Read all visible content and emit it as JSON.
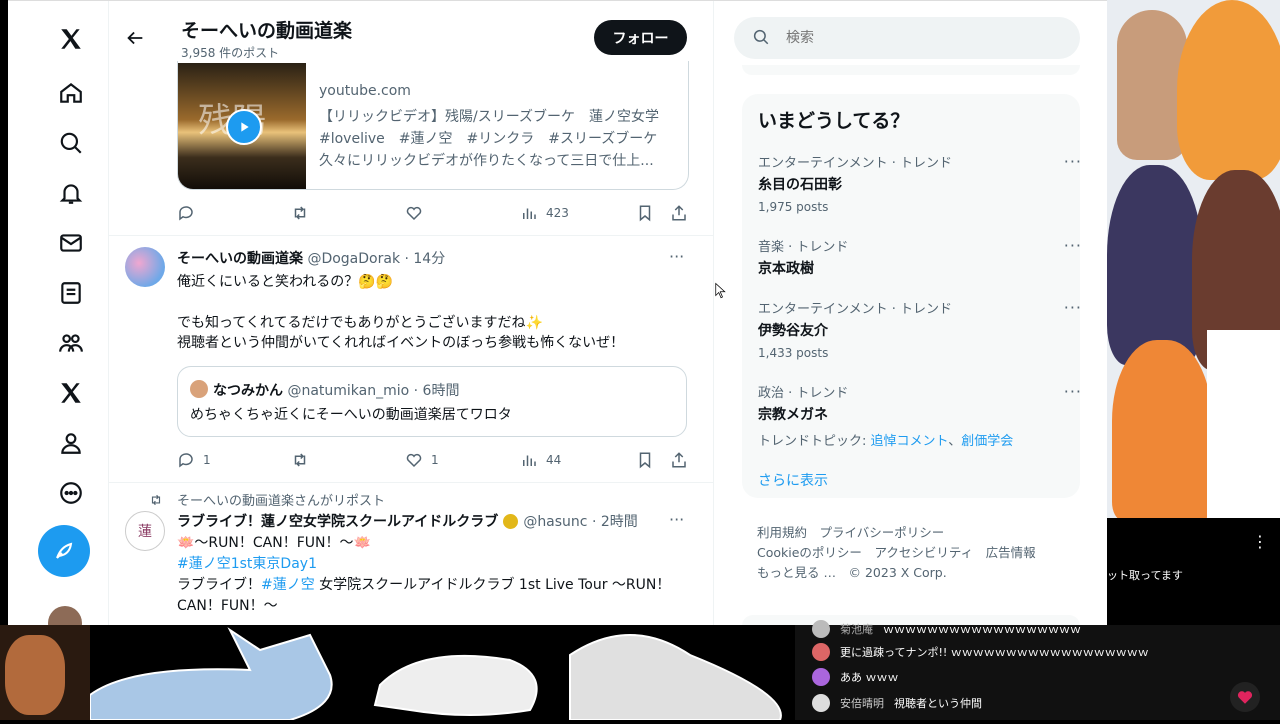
{
  "nav": {
    "icons": [
      "x-logo-icon",
      "home-icon",
      "search-icon",
      "bell-icon",
      "mail-icon",
      "list-icon",
      "communities-icon",
      "premium-x-icon",
      "profile-icon",
      "more-circle-icon"
    ],
    "compose_color": "#1d9bf0"
  },
  "header": {
    "title": "そーへいの動画道楽",
    "posts_count": "3,958 件のポスト",
    "follow_label": "フォロー"
  },
  "card": {
    "domain": "youtube.com",
    "title": "【リリックビデオ】残陽/スリーズブーケ　蓮ノ空女学",
    "tags": "#lovelive　#蓮ノ空　#リンクラ　#スリーズブーケ",
    "desc": "久々にリリックビデオが作りたくなって三日で仕上...",
    "thumb_text": "残陽",
    "views": "423"
  },
  "tweet1": {
    "name": "そーへいの動画道楽",
    "handle": "@DogaDorak · 14分",
    "line1": "俺近くにいると笑われるの？🤔🤔",
    "line2": "でも知ってくれてるだけでもありがとうございますだね✨",
    "line3": "視聴者という仲間がいてくれればイベントのぼっち参戦も怖くないぜ！",
    "quote": {
      "name": "なつみかん",
      "handle": "@natumikan_mio · 6時間",
      "text": "めちゃくちゃ近くにそーへいの動画道楽居てワロタ"
    },
    "replies": "1",
    "likes": "1",
    "views": "44"
  },
  "tweet2": {
    "repost_label": "そーへいの動画道楽さんがリポスト",
    "name": "ラブライブ！蓮ノ空女学院スクールアイドルクラブ",
    "handle": "@hasunc · 2時間",
    "line1": "🪷～RUN！CAN！FUN！～🪷",
    "hashtag": "#蓮ノ空1st東京Day1",
    "line3a": "ラブライブ！",
    "line3tag": "#蓮ノ空",
    "line3b": " 女学院スクールアイドルクラブ 1st Live Tour ～RUN！",
    "line4": "CAN！FUN！～"
  },
  "search": {
    "placeholder": "検索"
  },
  "trends": {
    "title": "いまどうしてる？",
    "items": [
      {
        "meta": "エンターテインメント · トレンド",
        "name": "糸目の石田彰",
        "count": "1,975 posts"
      },
      {
        "meta": "音楽 · トレンド",
        "name": "京本政樹",
        "count": ""
      },
      {
        "meta": "エンターテインメント · トレンド",
        "name": "伊勢谷友介",
        "count": "1,433 posts"
      },
      {
        "meta": "政治 · トレンド",
        "name": "宗教メガネ",
        "count": ""
      }
    ],
    "topic_label": "トレンドトピック: ",
    "topic1": "追悼コメント",
    "topic_sep": "、",
    "topic2": "創価学会",
    "show_more": "さらに表示"
  },
  "footer": {
    "l1a": "利用規約",
    "l1b": "プライバシーポリシー",
    "l2a": "Cookieのポリシー",
    "l2b": "アクセシビリティ",
    "l2c": "広告情報",
    "l3a": "もっと見る …",
    "l3b": "© 2023 X Corp."
  },
  "chat": {
    "top_text": "ット取ってます",
    "lines": [
      {
        "user": "菊池庵",
        "text": "ｗｗｗｗｗｗｗｗｗｗｗｗｗｗｗｗｗｗ"
      },
      {
        "user": "",
        "text": "更に過疎ってナンポ!! ｗｗｗｗｗｗｗｗｗｗｗｗｗｗｗｗｗｗ"
      },
      {
        "user": "",
        "text": "ああ ｗｗｗ"
      },
      {
        "user": "安倍晴明",
        "text": "視聴者という仲間"
      }
    ],
    "heart_color": "#e0245e"
  }
}
